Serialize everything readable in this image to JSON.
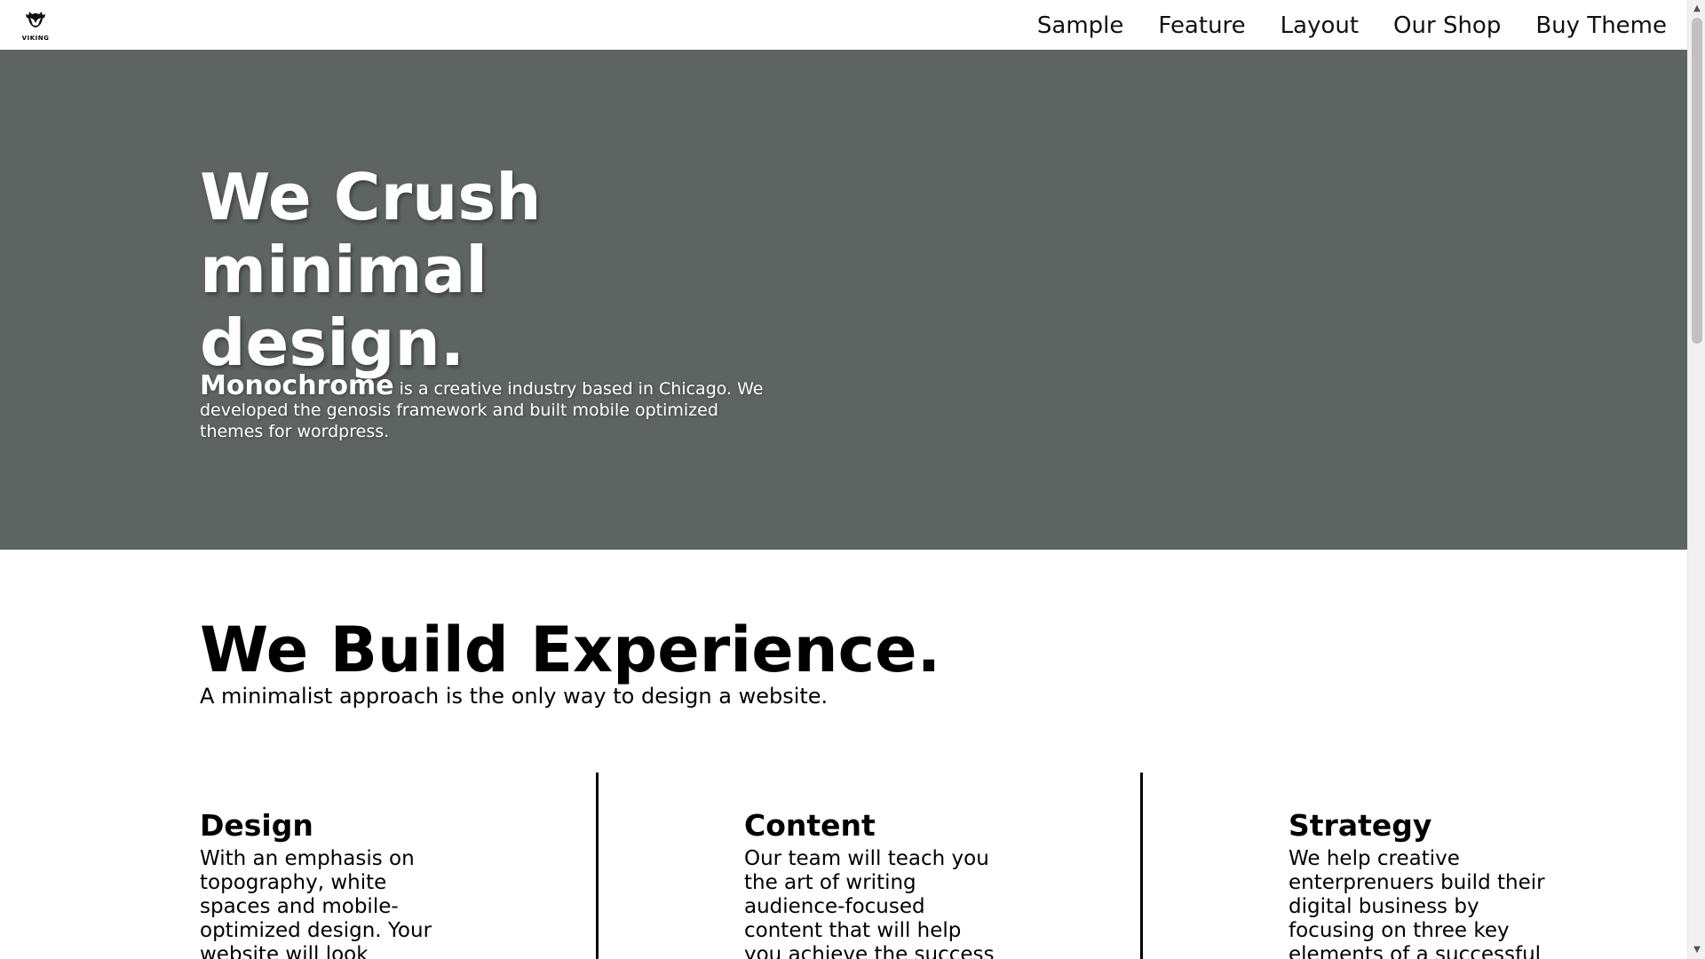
{
  "nav": {
    "logo_text": "VIKING",
    "items": [
      "Sample",
      "Feature",
      "Layout",
      "Our Shop",
      "Buy Theme"
    ]
  },
  "hero": {
    "title": "We Crush minimal design.",
    "brand": "Monochrome",
    "description": " is a creative industry based in Chicago. We developed the genosis framework and built mobile optimized themes for wordpress."
  },
  "section": {
    "title": "We Build Experience.",
    "subtitle": "A minimalist approach is the only way to design a website."
  },
  "features": [
    {
      "title": "Design",
      "text": "With an emphasis on topography, white spaces and mobile-optimized design. Your website will look absoulutely"
    },
    {
      "title": "Content",
      "text": "Our team will teach you the art of writing audience-focused content that will help you achieve the success you truely"
    },
    {
      "title": "Strategy",
      "text": "We help creative enterprenuers build their digital business by focusing on three key elements of a successful"
    }
  ],
  "icons": {
    "logo": "viking-helmet-icon",
    "scroll_up": "arrow-up-icon",
    "scroll_down": "arrow-down-icon"
  },
  "colors": {
    "hero_background": "#5e6462",
    "text": "#000000",
    "page_background": "#ffffff"
  }
}
